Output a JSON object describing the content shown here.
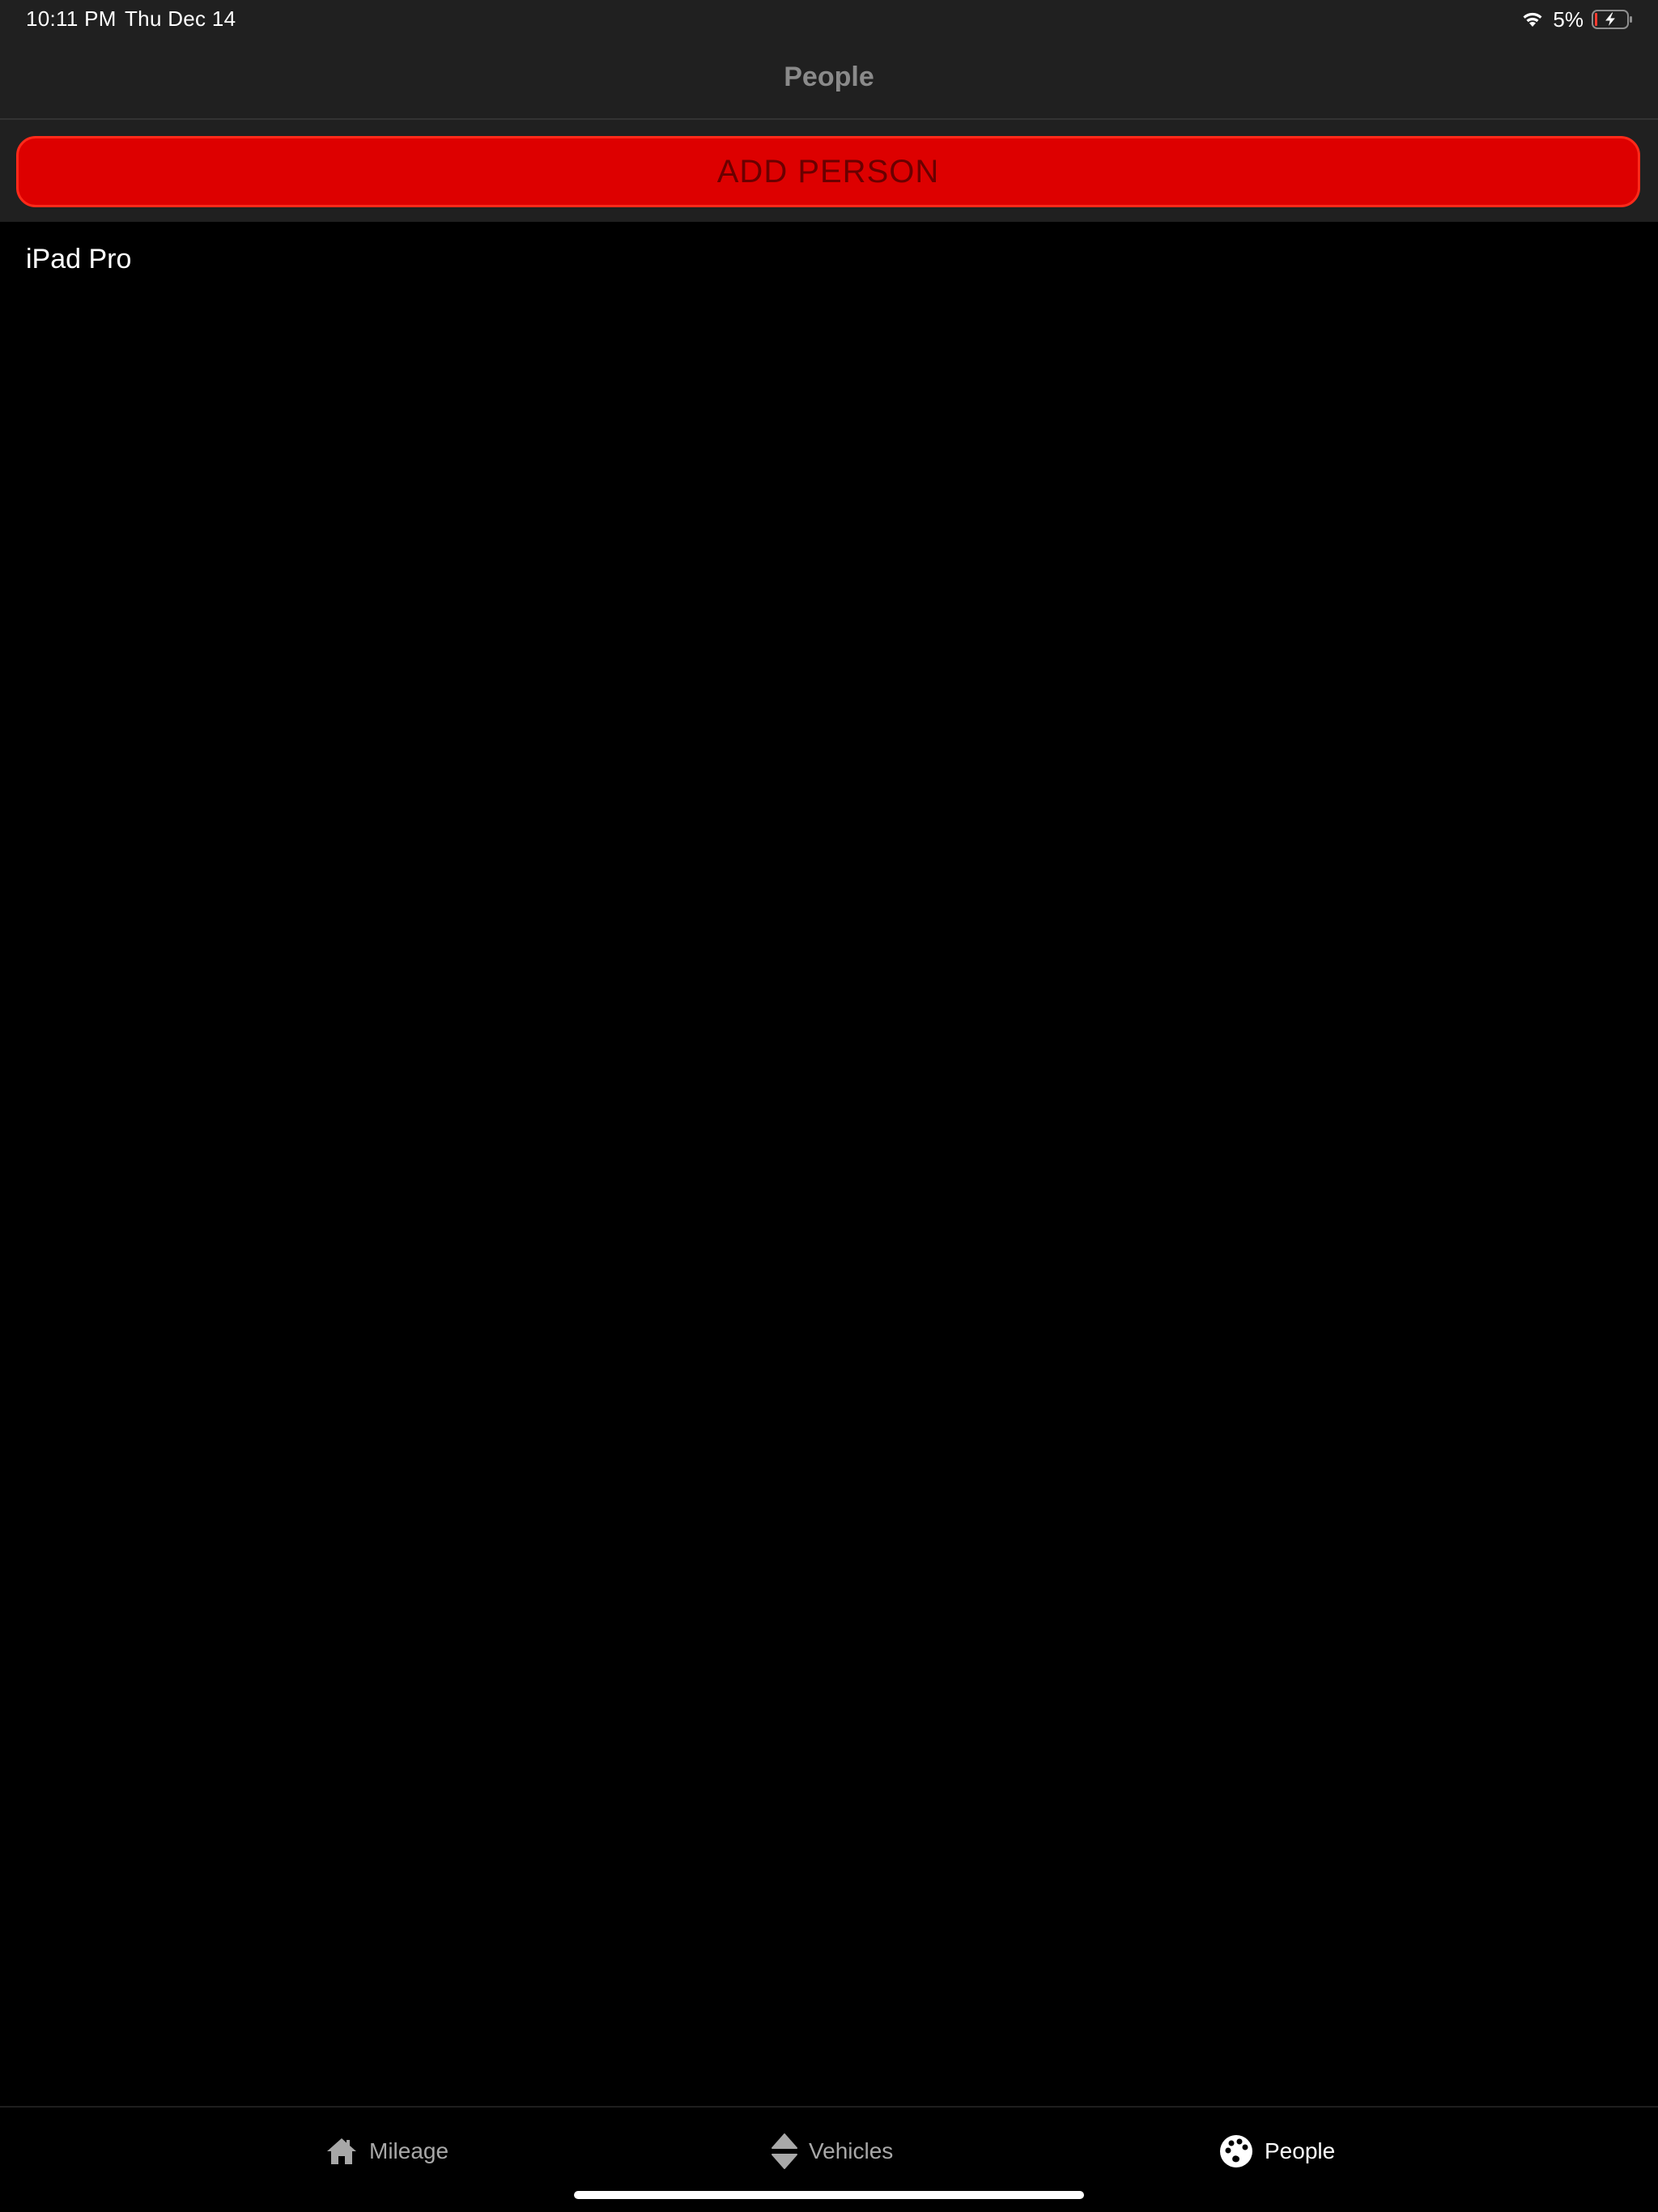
{
  "status_bar": {
    "time": "10:11 PM",
    "date": "Thu Dec 14",
    "battery_percent": "5%",
    "battery_level": 0.05,
    "charging": true,
    "icons": [
      "wifi-icon",
      "battery-charging-icon"
    ]
  },
  "nav": {
    "title": "People"
  },
  "actions": {
    "add_person_label": "ADD PERSON"
  },
  "people": [
    {
      "name": "iPad Pro"
    }
  ],
  "tabs": [
    {
      "label": "Mileage",
      "icon": "home-icon",
      "active": false
    },
    {
      "label": "Vehicles",
      "icon": "up-down-arrows-icon",
      "active": false
    },
    {
      "label": "People",
      "icon": "palette-icon",
      "active": true
    }
  ],
  "colors": {
    "accent": "#dd0000",
    "accent_text": "#6a0000",
    "bar_background": "#202020",
    "background": "#000000",
    "battery_low": "#ff3b30"
  }
}
